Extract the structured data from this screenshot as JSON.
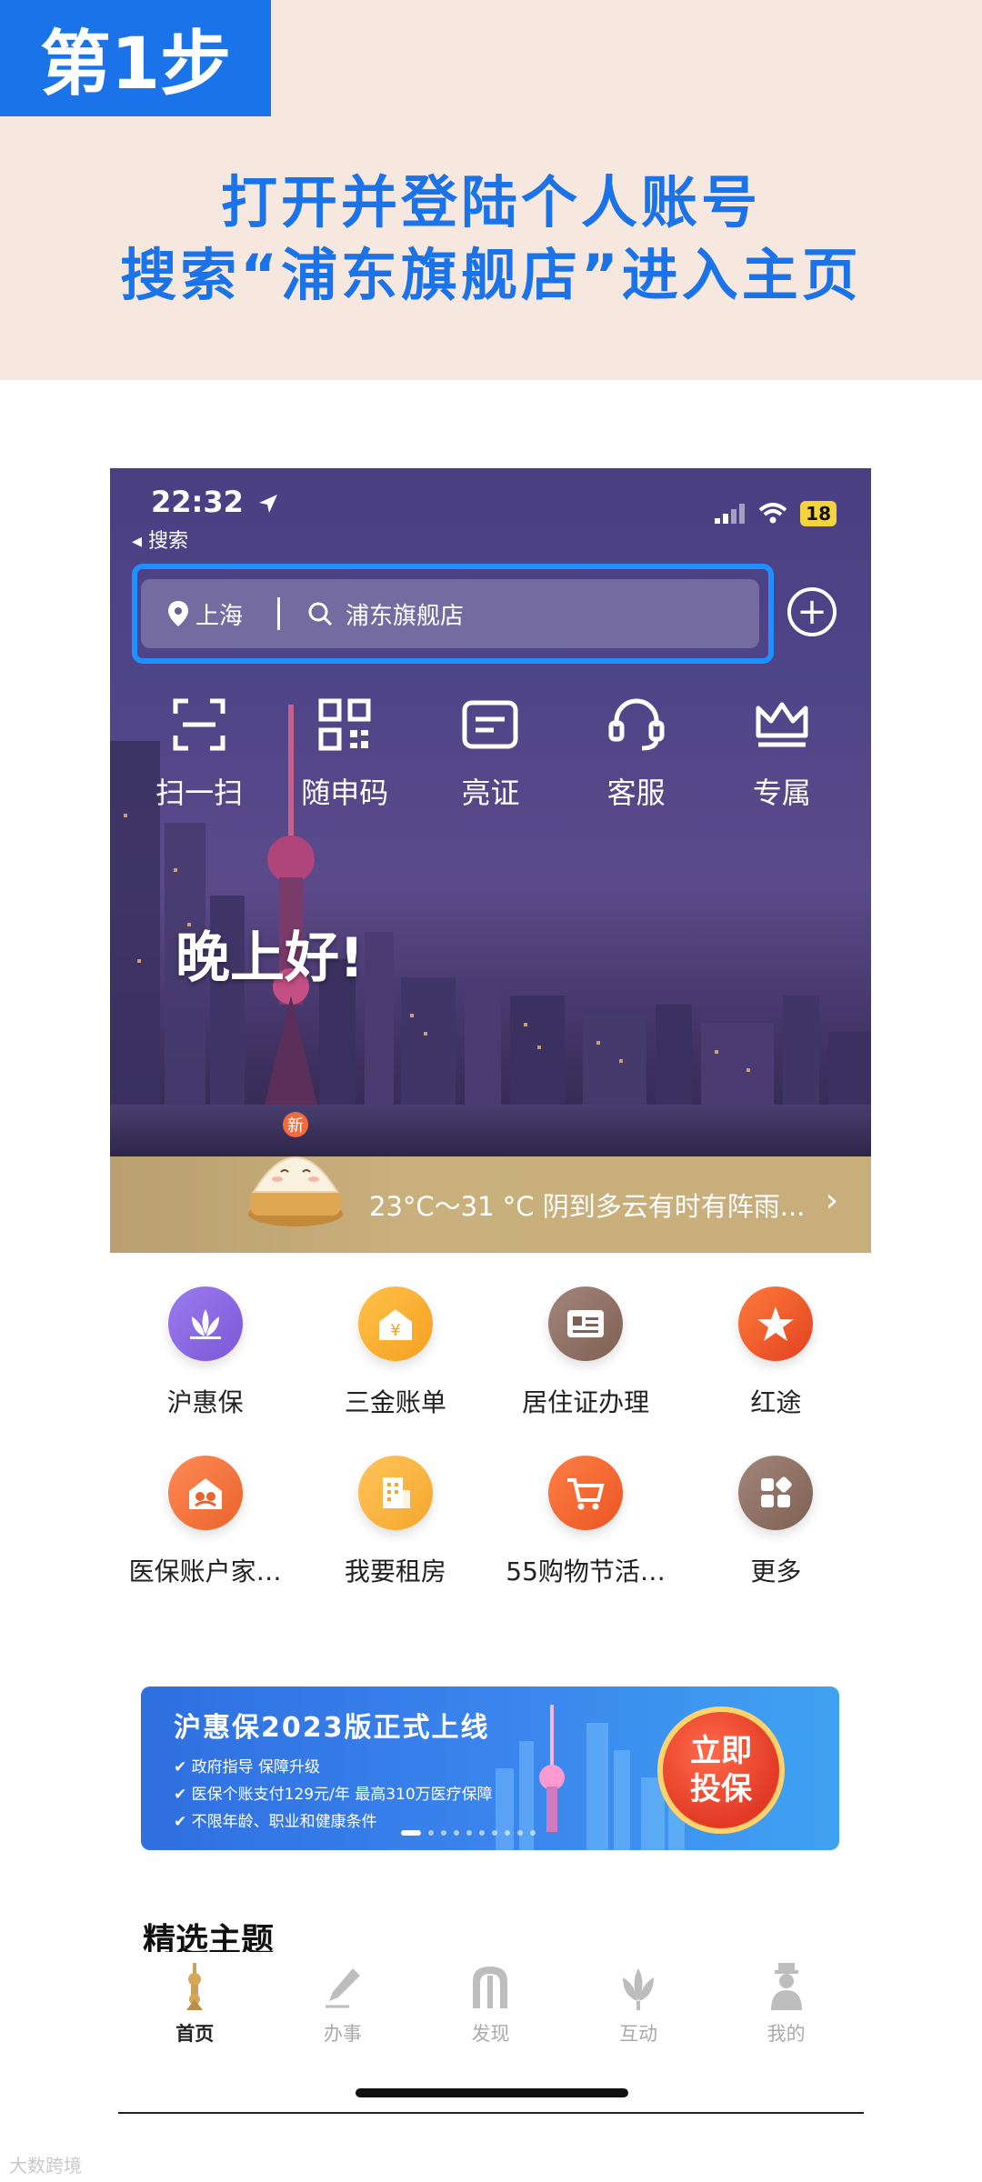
{
  "banner": {
    "step": "第1步",
    "line1": "打开并登陆个人账号",
    "line2": "搜索“浦东旗舰店”进入主页"
  },
  "status": {
    "time": "22:32",
    "back_label": "◂ 搜索",
    "battery": "18"
  },
  "search": {
    "location": "上海",
    "query": "浦东旗舰店"
  },
  "quick_actions": [
    {
      "label": "扫一扫",
      "icon": "scan-icon"
    },
    {
      "label": "随申码",
      "icon": "qr-code-icon"
    },
    {
      "label": "亮证",
      "icon": "id-card-icon"
    },
    {
      "label": "客服",
      "icon": "headset-icon"
    },
    {
      "label": "专属",
      "icon": "crown-icon"
    }
  ],
  "greeting": "晚上好!",
  "weather": {
    "text": "23°C～31 °C 阴到多云有时有阵雨...",
    "badge": "新"
  },
  "services": [
    {
      "label": "沪惠保",
      "icon": "lotus-icon",
      "color": "#8a6be0"
    },
    {
      "label": "三金账单",
      "icon": "yuan-house-icon",
      "color": "#f5a623"
    },
    {
      "label": "居住证办理",
      "icon": "id-card-icon",
      "color": "#8b6a5c"
    },
    {
      "label": "红途",
      "icon": "star-icon",
      "color": "#e9542b"
    },
    {
      "label": "医保账户家…",
      "icon": "family-house-icon",
      "color": "#f07a45"
    },
    {
      "label": "我要租房",
      "icon": "building-icon",
      "color": "#f5b240"
    },
    {
      "label": "55购物节活…",
      "icon": "cart-icon",
      "color": "#f06a35"
    },
    {
      "label": "更多",
      "icon": "apps-icon",
      "color": "#8b6a5c"
    }
  ],
  "promo": {
    "title": "沪惠保2023版正式上线",
    "line1": "✔ 政府指导 保障升级",
    "line2": "✔ 医保个账支付129元/年 最高310万医疗保障",
    "line3": "✔ 不限年龄、职业和健康条件",
    "cta_line1": "立即",
    "cta_line2": "投保"
  },
  "section_title": "精选主题",
  "tabs": [
    {
      "label": "首页",
      "icon": "home-tower-icon",
      "active": true
    },
    {
      "label": "办事",
      "icon": "pen-icon",
      "active": false
    },
    {
      "label": "发现",
      "icon": "arch-icon",
      "active": false
    },
    {
      "label": "互动",
      "icon": "magnolia-icon",
      "active": false
    },
    {
      "label": "我的",
      "icon": "person-icon",
      "active": false
    }
  ],
  "watermark": "大数跨境"
}
